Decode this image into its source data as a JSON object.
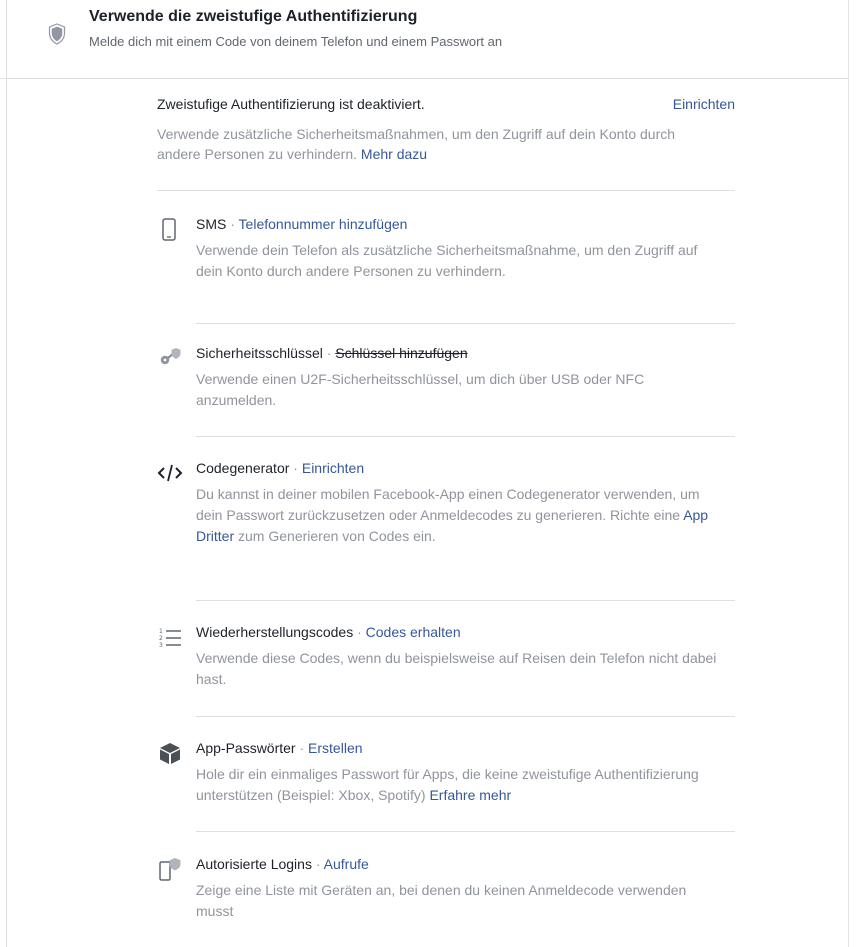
{
  "header": {
    "title": "Verwende die zweistufige Authentifizierung",
    "subtitle": "Melde dich mit einem Code von deinem Telefon und einem Passwort an",
    "icon": "shield-icon"
  },
  "status": {
    "title": "Zweistufige Authentifizierung ist deaktiviert.",
    "action": "Einrichten",
    "description": "Verwende zusätzliche Sicherheitsmaßnahmen, um den Zugriff auf dein Konto durch andere Personen zu verhindern.",
    "more_link": "Mehr dazu"
  },
  "methods": {
    "sms": {
      "icon": "phone-icon",
      "name": "SMS",
      "separator": "·",
      "action": "Telefonnummer hinzufügen",
      "description": "Verwende dein Telefon als zusätzliche Sicherheitsmaßnahme, um den Zugriff auf dein Konto durch andere Personen zu verhindern."
    },
    "security_key": {
      "icon": "key-icon",
      "name": "Sicherheitsschlüssel",
      "separator": "·",
      "action": "Schlüssel hinzufügen",
      "description": "Verwende einen U2F-Sicherheitsschlüssel, um dich über USB oder NFC anzumelden."
    },
    "code_generator": {
      "icon": "code-icon",
      "name": "Codegenerator",
      "separator": "·",
      "action": "Einrichten",
      "description_before": "Du kannst in deiner mobilen Facebook-App einen Codegenerator verwenden, um dein Passwort zurückzusetzen oder Anmeldecodes zu generieren. Richte eine",
      "description_link": "App Dritter",
      "description_after": "zum Generieren von Codes ein."
    },
    "recovery_codes": {
      "icon": "list-icon",
      "name": "Wiederherstellungscodes",
      "separator": "·",
      "action": "Codes erhalten",
      "description": "Verwende diese Codes, wenn du beispielsweise auf Reisen dein Telefon nicht dabei hast."
    },
    "app_passwords": {
      "icon": "cube-icon",
      "name": "App-Passwörter",
      "separator": "·",
      "action": "Erstellen",
      "description": "Hole dir ein einmaliges Passwort für Apps, die keine zweistufige Authentifizierung unterstützen (Beispiel: Xbox, Spotify)",
      "link": "Erfahre mehr"
    },
    "authorized_logins": {
      "icon": "device-shield-icon",
      "name": "Autorisierte Logins",
      "separator": "·",
      "action": "Aufrufe",
      "description": "Zeige eine Liste mit Geräten an, bei denen du keinen Anmeldecode verwenden musst"
    }
  },
  "colors": {
    "link": "#365899",
    "text": "#1d2129",
    "muted": "#90949c",
    "divider": "#dddfe2"
  }
}
